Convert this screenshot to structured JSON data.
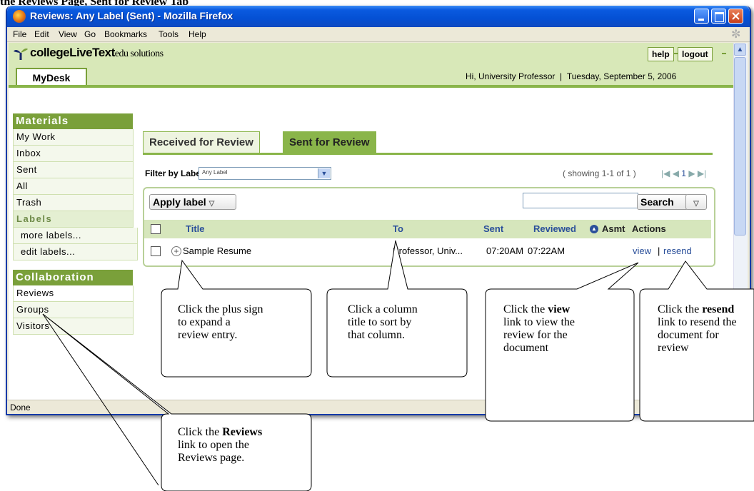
{
  "caption": {
    "text": "the Reviews Page, Sent for Review Tab"
  },
  "window": {
    "title": "Reviews: Any Label (Sent) - Mozilla Firefox",
    "menu": [
      "File",
      "Edit",
      "View",
      "Go",
      "Bookmarks",
      "Tools",
      "Help"
    ],
    "status": "Done"
  },
  "header": {
    "logo_bold": "collegeLiveText",
    "logo_rest": "edu solutions",
    "help": "help",
    "logout": "logout",
    "mydesk_tab": "MyDesk",
    "greeting": "Hi, University Professor",
    "separator": "|",
    "date": "Tuesday, September 5, 2006"
  },
  "sidebar": {
    "materials_heading": "Materials",
    "materials_items": [
      "My Work",
      "Inbox",
      "Sent",
      "All",
      "Trash"
    ],
    "labels_heading": "Labels",
    "label_items": [
      "more labels...",
      "edit labels..."
    ],
    "collaboration_heading": "Collaboration",
    "collaboration_items": [
      "Reviews",
      "Groups",
      "Visitors"
    ]
  },
  "main": {
    "tabs": [
      "Received for Review",
      "Sent for Review"
    ],
    "active_tab": "Sent for Review",
    "filter_label": "Filter by Label:",
    "filter_value": "Any Label",
    "showing": "( showing 1-1 of 1 )",
    "page": "1",
    "apply_label": "Apply label",
    "search_button": "Search",
    "search_value": "",
    "columns": [
      "Title",
      "To",
      "Sent",
      "Reviewed",
      "Asmt",
      "Actions"
    ],
    "rows": [
      {
        "title": "Sample Resume",
        "to": "Professor, Univ...",
        "sent": "07:20AM",
        "reviewed": "07:22AM",
        "view": "view",
        "sep": "|",
        "resend": "resend"
      }
    ]
  },
  "callouts": {
    "plus": [
      "Click the plus sign",
      "to expand a",
      "review entry."
    ],
    "column": [
      "Click a column",
      "title to sort by",
      "that column."
    ],
    "view_pre": "Click the",
    "view_bold": "view",
    "view_lines": [
      "link to view the",
      "review for the",
      "document"
    ],
    "resend_pre": "Click the",
    "resend_bold": "resend",
    "resend_lines": [
      "link to resend the",
      "document for",
      "review"
    ],
    "reviews_pre": "Click the",
    "reviews_bold": "Reviews",
    "reviews_lines": [
      "link to open the",
      "Reviews page."
    ]
  },
  "colors": {
    "accent_green": "#8ab54a",
    "header_green": "#d8e8b8",
    "link_blue": "#2a4f9a",
    "titlebar_blue": "#0450d4"
  }
}
